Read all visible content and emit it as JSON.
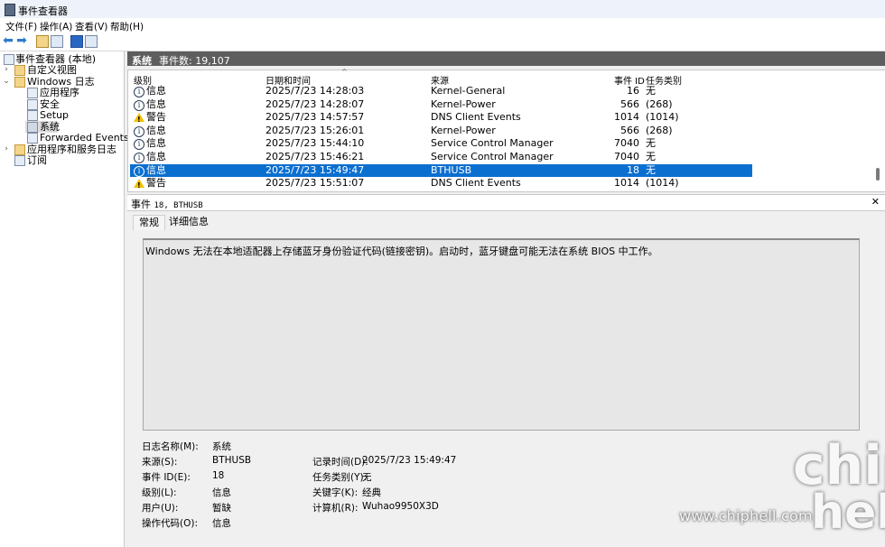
{
  "window": {
    "title": "事件查看器"
  },
  "menu": [
    "文件(F)",
    "操作(A)",
    "查看(V)",
    "帮助(H)"
  ],
  "toolbar": {
    "icons": [
      "back-arrow-icon",
      "forward-arrow-icon",
      "folder-up-icon",
      "pane-icon",
      "help-icon",
      "pane-toggle-icon"
    ]
  },
  "tree": {
    "root": "事件查看器 (本地)",
    "custom_views": "自定义视图",
    "windows_logs": "Windows 日志",
    "logs": [
      "应用程序",
      "安全",
      "Setup",
      "系统",
      "Forwarded Events"
    ],
    "app_services": "应用程序和服务日志",
    "subscriptions": "订阅"
  },
  "pane": {
    "title": "系统",
    "count_label": "事件数: 19,107"
  },
  "grid": {
    "columns": [
      "级别",
      "日期和时间",
      "来源",
      "事件 ID",
      "任务类别"
    ],
    "rows": [
      {
        "level": "信息",
        "type": "info",
        "date": "2025/7/23 14:28:03",
        "source": "Kernel-General",
        "id": "16",
        "task": "无"
      },
      {
        "level": "信息",
        "type": "info",
        "date": "2025/7/23 14:28:07",
        "source": "Kernel-Power",
        "id": "566",
        "task": "(268)"
      },
      {
        "level": "警告",
        "type": "warn",
        "date": "2025/7/23 14:57:57",
        "source": "DNS Client Events",
        "id": "1014",
        "task": "(1014)"
      },
      {
        "level": "信息",
        "type": "info",
        "date": "2025/7/23 15:26:01",
        "source": "Kernel-Power",
        "id": "566",
        "task": "(268)"
      },
      {
        "level": "信息",
        "type": "info",
        "date": "2025/7/23 15:44:10",
        "source": "Service Control Manager",
        "id": "7040",
        "task": "无"
      },
      {
        "level": "信息",
        "type": "info",
        "date": "2025/7/23 15:46:21",
        "source": "Service Control Manager",
        "id": "7040",
        "task": "无"
      },
      {
        "level": "信息",
        "type": "info",
        "date": "2025/7/23 15:49:47",
        "source": "BTHUSB",
        "id": "18",
        "task": "无"
      },
      {
        "level": "警告",
        "type": "warn",
        "date": "2025/7/23 15:51:07",
        "source": "DNS Client Events",
        "id": "1014",
        "task": "(1014)"
      }
    ],
    "selected_index": 6
  },
  "detail": {
    "title_prefix": "事件",
    "title_mono": "18, BTHUSB",
    "tabs": [
      "常规",
      "详细信息"
    ],
    "description": "Windows 无法在本地适配器上存储蓝牙身份验证代码(链接密钥)。启动时，蓝牙键盘可能无法在系统 BIOS 中工作。",
    "fields": {
      "log_name_label": "日志名称(M):",
      "log_name": "系统",
      "source_label": "来源(S):",
      "source": "BTHUSB",
      "logged_label": "记录时间(D):",
      "logged": "2025/7/23 15:49:47",
      "event_id_label": "事件 ID(E):",
      "event_id": "18",
      "task_label": "任务类别(Y):",
      "task": "无",
      "level_label": "级别(L):",
      "level": "信息",
      "keywords_label": "关键字(K):",
      "keywords": "经典",
      "user_label": "用户(U):",
      "user": "暂缺",
      "computer_label": "计算机(R):",
      "computer": "Wuhao9950X3D",
      "opcode_label": "操作代码(O):",
      "opcode": "信息"
    }
  },
  "watermark": {
    "url": "www.chiphell.com",
    "logo_top": "chip",
    "logo_bottom": "hell"
  }
}
